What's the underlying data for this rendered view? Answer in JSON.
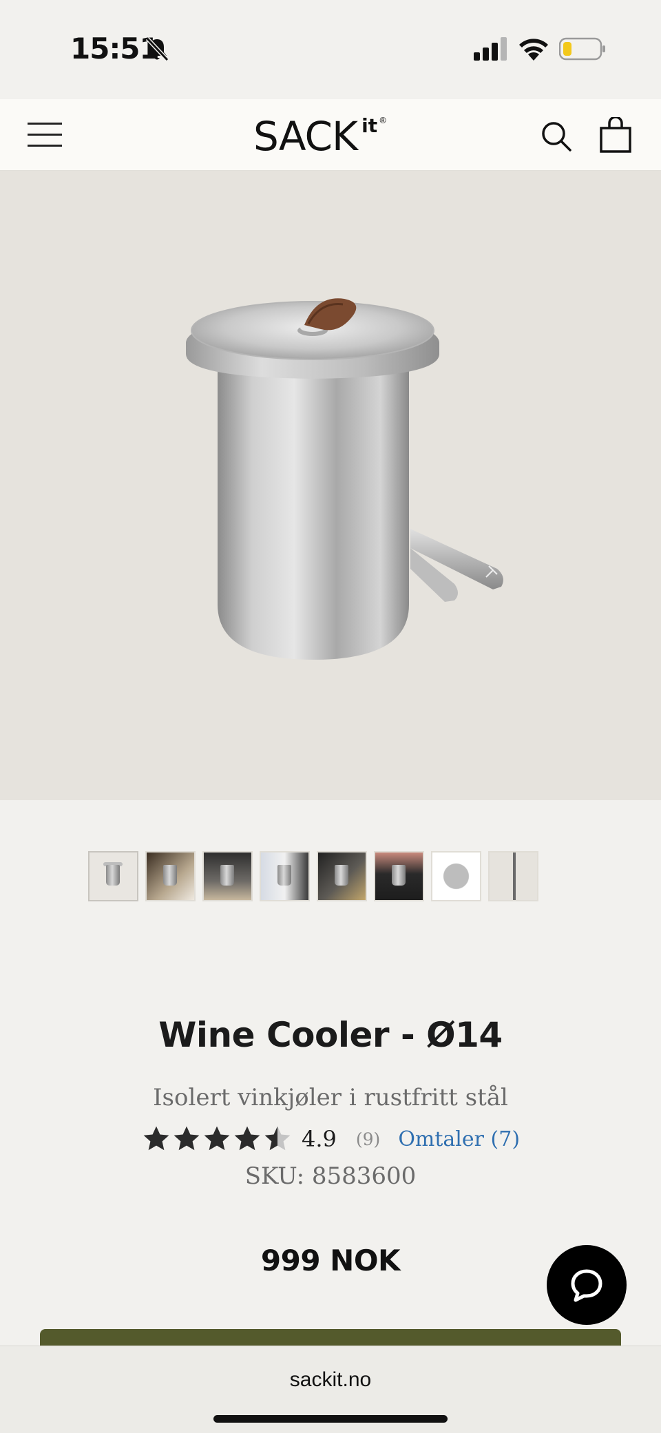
{
  "status_bar": {
    "time": "15:51",
    "icons": [
      "bell-slash-icon",
      "signal-icon",
      "wifi-icon",
      "battery-low-icon"
    ]
  },
  "header": {
    "logo": "SACK",
    "logo_sup": "it",
    "logo_reg": "®",
    "icons": [
      "hamburger-menu-icon",
      "search-icon",
      "shopping-bag-icon"
    ]
  },
  "gallery": {
    "thumbnail_count": 8,
    "active_index": 0
  },
  "product": {
    "title": "Wine Cooler - Ø14",
    "subtitle": "Isolert vinkjøler i rustfritt stål",
    "rating": "4.9",
    "rating_count": "(9)",
    "reviews_link": "Omtaler (7)",
    "stars_filled": 4.5,
    "sku": "SKU: 8583600",
    "price": "999 NOK"
  },
  "colors": {
    "background": "#f2f1ee",
    "hero": "#e6e3dd",
    "accent_link": "#2f6fb0",
    "add_to_cart": "#545a2c"
  },
  "browser": {
    "url": "sackit.no"
  }
}
